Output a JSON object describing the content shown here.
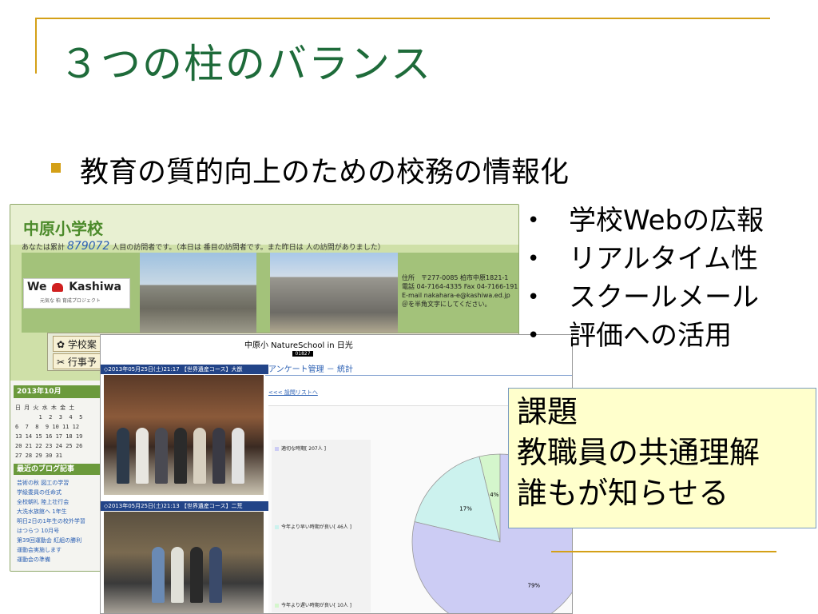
{
  "slide": {
    "title": "３つの柱のバランス",
    "main_bullet": "教育の質的向上のための校務の情報化",
    "sub_bullets": [
      {
        "label": "学校Webの広報"
      },
      {
        "label": "リアルタイム性"
      },
      {
        "label": "スクールメール"
      },
      {
        "label": "評価への活用"
      }
    ],
    "kadai": {
      "line1": "課題",
      "line2": "教職員の共通理解",
      "line3": "誰もが知らせる"
    },
    "colors": {
      "title": "#1e6b3a",
      "accent": "#d4a017",
      "callout_bg": "#ffffcc"
    }
  },
  "school_site": {
    "title": "中原小学校",
    "counter_prefix": "あなたは累計",
    "counter_value": "879072",
    "counter_suffix": "人目の訪問者です。（本日は",
    "counter_rest": "番目の訪問者です。また昨日は",
    "counter_end": "人の訪問がありました）",
    "logo_main_left": "We",
    "logo_main_right": "Kashiwa",
    "logo_sub": "元気な 柏 育成プロジェクト",
    "address_lines": [
      "住所　〒277-0085 柏市中原1821-1",
      "電話 04-7164-4335 Fax 04-7166-1912",
      "E-mail nakahara-e@kashiwa.ed.jp",
      "＠を半角文字にしてください。"
    ],
    "nav": [
      "学校案",
      "行事予"
    ],
    "calendar_title": "2013年10月",
    "calendar_grid": "日 月 火 水 木 金 土\n       1  2  3  4  5\n6  7  8  9 10 11 12\n13 14 15 16 17 18 19\n20 21 22 23 24 25 26\n27 28 29 30 31",
    "blog_title": "最近のブログ記事",
    "blog_items": [
      "芸術の秋 図工の学習",
      "学級委員の任命式",
      "全校朝礼 陸上壮行会",
      "大洗水族館へ 1年生",
      "明日2日の1年生の校外学習",
      "はつらつ 10月号",
      "第39回運動会 紅組の勝利",
      "運動会実施します",
      "運動会の準備"
    ]
  },
  "nature_school": {
    "title": "中原小 NatureSchool in 日光",
    "counter": "01827",
    "bar1": "◇2013年05月25日(土)21:17 【世界遺産コース】大猷",
    "bar2": "◇2013年05月25日(土)21:13 【世界遺産コース】二荒",
    "anket_title": "アンケート管理 － 統計",
    "back_link": "<<< 設問リストへ"
  },
  "chart_data": {
    "type": "pie",
    "categories": [
      "適切な時期[ 207人 ]",
      "今年より早い時期が良い[ 46人 ]",
      "今年より遅い時期が良い[ 10人 ]"
    ],
    "values": [
      207,
      46,
      10
    ],
    "percent_labels": [
      "79%",
      "17%",
      "4%"
    ],
    "colors": [
      "#ccccf4",
      "#ccf2ee",
      "#d4f6cc"
    ],
    "legend_position": "left"
  }
}
